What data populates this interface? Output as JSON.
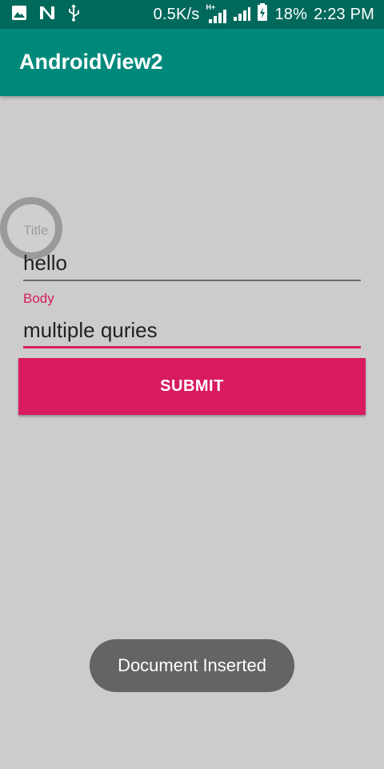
{
  "status_bar": {
    "left_icons": [
      "image-icon",
      "n-notification-icon",
      "usb-icon"
    ],
    "network_speed": "0.5K/s",
    "network_type": "H+",
    "battery_percent": "18%",
    "time": "2:23 PM"
  },
  "app_bar": {
    "title": "AndroidView2"
  },
  "form": {
    "title_label": "Title",
    "title_value": "hello",
    "body_label": "Body",
    "body_value": "multiple quries",
    "submit_label": "SUBMIT"
  },
  "toast": {
    "message": "Document Inserted"
  },
  "colors": {
    "status_bar": "#00695c",
    "primary": "#00897b",
    "accent": "#d81b60",
    "background": "#cccccc"
  }
}
